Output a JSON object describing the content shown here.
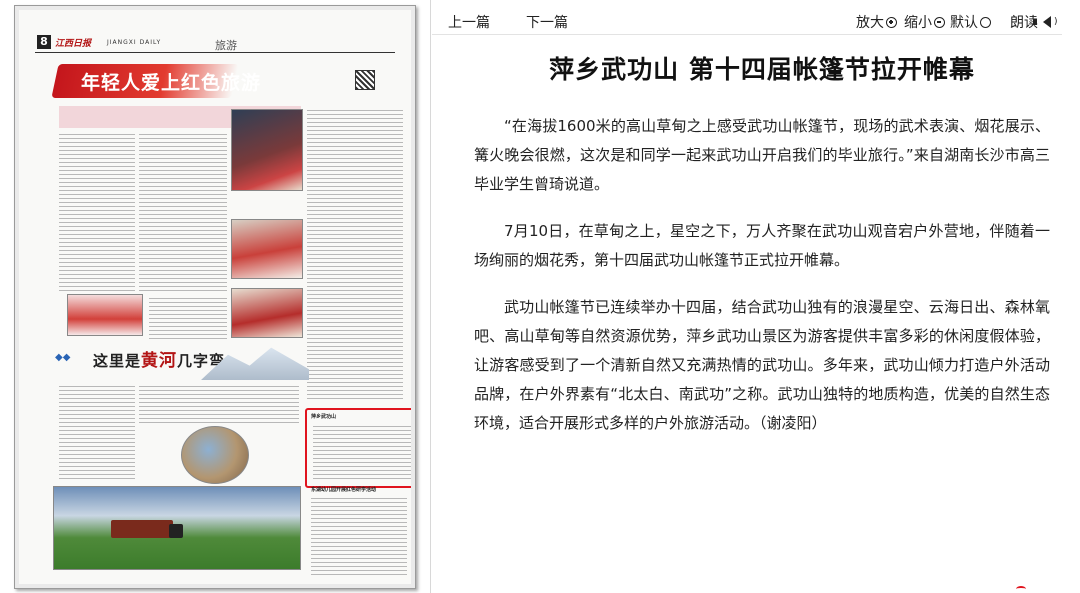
{
  "newspaper": {
    "page_number": "8",
    "masthead_logo": "江西日报",
    "masthead_en": "JIANGXI DAILY",
    "section": "旅游",
    "headline_top": "年轻人爱上红色旅游",
    "headline_bottom_pre": "这里是",
    "headline_bottom_hl": "黄河",
    "headline_bottom_post": "几字弯",
    "highlighted_story_title": "萍乡武功山",
    "bottom_story_title": "东湖幼儿园开展红色研学活动"
  },
  "toolbar": {
    "prev": "上一篇",
    "next": "下一篇",
    "zoom_in": "放大",
    "zoom_out": "缩小",
    "default": "默认",
    "read_aloud": "朗读"
  },
  "article": {
    "title": "萍乡武功山  第十四届帐篷节拉开帷幕",
    "paragraphs": [
      "“在海拔1600米的高山草甸之上感受武功山帐篷节，现场的武术表演、烟花展示、篝火晚会很燃，这次是和同学一起来武功山开启我们的毕业旅行。”来自湖南长沙市高三毕业学生曾琦说道。",
      "7月10日，在草甸之上，星空之下，万人齐聚在武功山观音宕户外营地，伴随着一场绚丽的烟花秀，第十四届武功山帐篷节正式拉开帷幕。",
      "武功山帐篷节已连续举办十四届，结合武功山独有的浪漫星空、云海日出、森林氧吧、高山草甸等自然资源优势，萍乡武功山景区为游客提供丰富多彩的休闲度假体验，让游客感受到了一个清新自然又充满热情的武功山。多年来，武功山倾力打造户外活动品牌，在户外界素有“北太白、南武功”之称。武功山独特的地质构造，优美的自然生态环境，适合开展形式多样的户外旅游活动。（谢凌阳）"
    ]
  },
  "colors": {
    "highlight_border": "#e0141e",
    "headline_red": "#c4161c"
  }
}
